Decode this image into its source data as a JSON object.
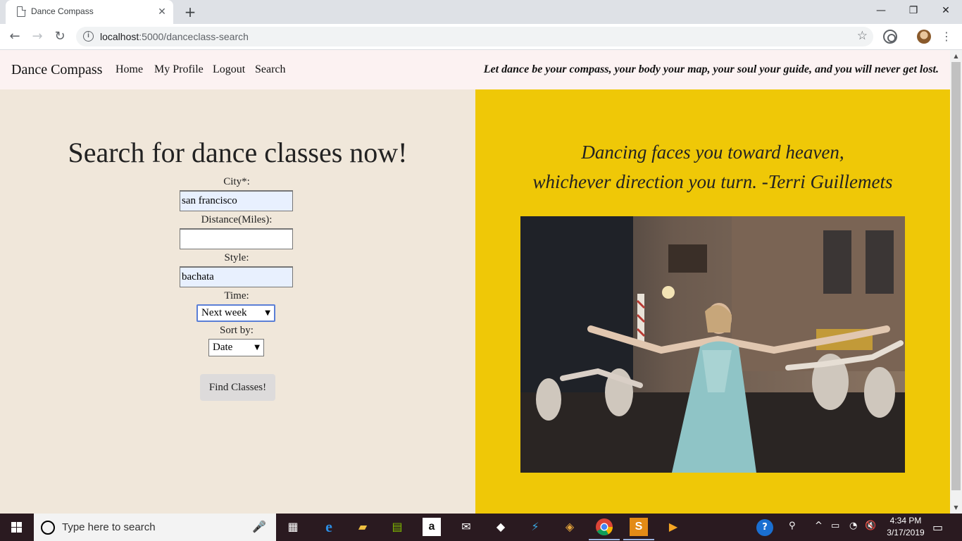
{
  "browser": {
    "tab_title": "Dance Compass",
    "url_host": "localhost",
    "url_rest": ":5000/danceclass-search",
    "tab_close": "✕",
    "new_tab": "+"
  },
  "site": {
    "brand": "Dance Compass",
    "nav": [
      "Home",
      "My Profile",
      "Logout",
      "Search"
    ],
    "tagline": "Let dance be your compass, your body your map, your soul your guide, and you will never get lost."
  },
  "form": {
    "heading": "Search for dance classes now!",
    "city_label": "City*:",
    "city_value": "san francisco",
    "distance_label": "Distance(Miles):",
    "distance_value": "",
    "style_label": "Style:",
    "style_value": "bachata",
    "time_label": "Time:",
    "time_value": "Next week",
    "sort_label": "Sort by:",
    "sort_value": "Date",
    "submit": "Find Classes!"
  },
  "quote": {
    "line1": "Dancing faces you toward heaven,",
    "line2": "whichever direction you turn. -Terri Guillemets"
  },
  "taskbar": {
    "search_placeholder": "Type here to search",
    "time": "4:34 PM",
    "date": "3/17/2019"
  },
  "colors": {
    "nav_bg": "#fcf2f2",
    "left_bg": "#f0e7da",
    "right_bg": "#efc807",
    "autofill_bg": "#e8f0fe"
  }
}
